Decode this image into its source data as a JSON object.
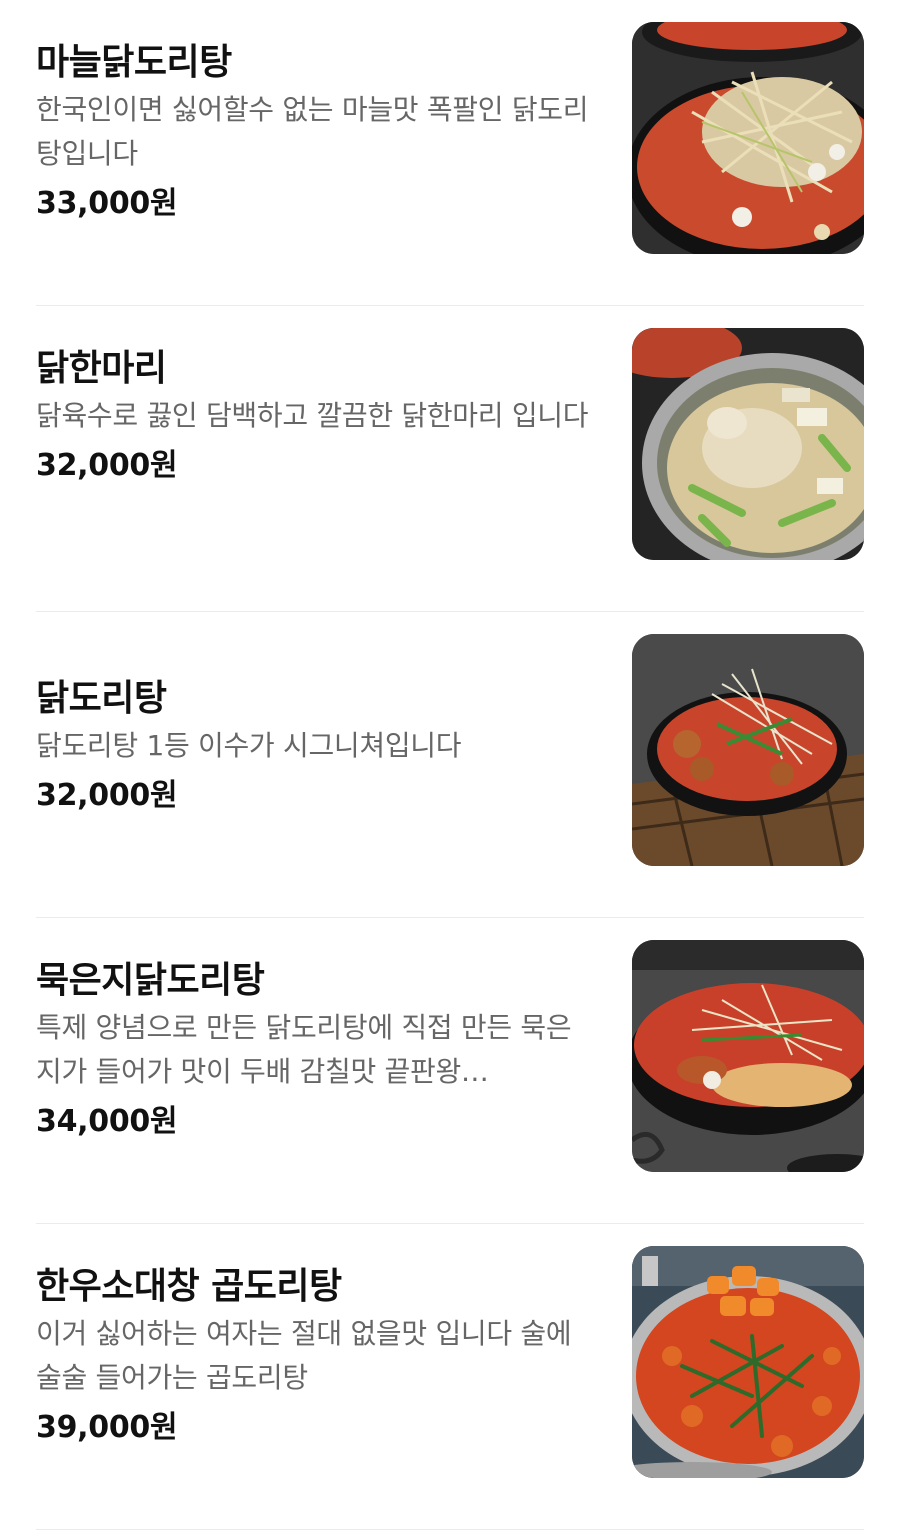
{
  "menu": {
    "items": [
      {
        "name": "마늘닭도리탕",
        "description": "한국인이면 싫어할수 없는 마늘맛 폭팔인 닭도리탕입니다",
        "price": "33,000원"
      },
      {
        "name": "닭한마리",
        "description": "닭육수로 끓인 담백하고 깔끔한 닭한마리 입니다",
        "price": "32,000원"
      },
      {
        "name": "닭도리탕",
        "description": "닭도리탕 1등 이수가 시그니쳐입니다",
        "price": "32,000원"
      },
      {
        "name": "묵은지닭도리탕",
        "description": "특제 양념으로 만든 닭도리탕에 직접 만든 묵은지가 들어가 맛이 두배 감칠맛 끝판왕…",
        "price": "34,000원"
      },
      {
        "name": "한우소대창 곱도리탕",
        "description": "이거 싫어하는 여자는 절대 없을맛 입니다 술에 술술 들어가는 곱도리탕",
        "price": "39,000원"
      }
    ]
  }
}
